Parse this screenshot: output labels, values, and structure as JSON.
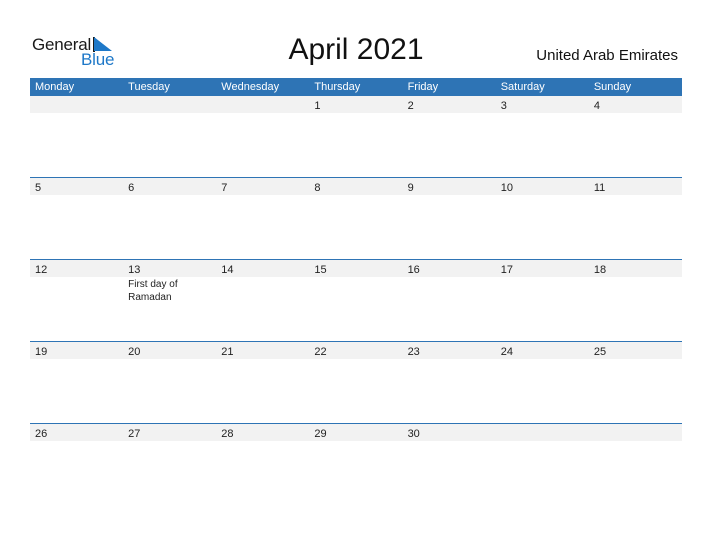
{
  "logo": {
    "word1": "General",
    "word2": "Blue",
    "accent_color": "#1e78c8"
  },
  "title": "April 2021",
  "country": "United Arab Emirates",
  "header_color": "#2e74b5",
  "weekdays": [
    "Monday",
    "Tuesday",
    "Wednesday",
    "Thursday",
    "Friday",
    "Saturday",
    "Sunday"
  ],
  "weeks": [
    {
      "days": [
        "",
        "",
        "",
        "1",
        "2",
        "3",
        "4"
      ],
      "events": [
        "",
        "",
        "",
        "",
        "",
        "",
        ""
      ]
    },
    {
      "days": [
        "5",
        "6",
        "7",
        "8",
        "9",
        "10",
        "11"
      ],
      "events": [
        "",
        "",
        "",
        "",
        "",
        "",
        ""
      ]
    },
    {
      "days": [
        "12",
        "13",
        "14",
        "15",
        "16",
        "17",
        "18"
      ],
      "events": [
        "",
        "First day of Ramadan",
        "",
        "",
        "",
        "",
        ""
      ]
    },
    {
      "days": [
        "19",
        "20",
        "21",
        "22",
        "23",
        "24",
        "25"
      ],
      "events": [
        "",
        "",
        "",
        "",
        "",
        "",
        ""
      ]
    },
    {
      "days": [
        "26",
        "27",
        "28",
        "29",
        "30",
        "",
        ""
      ],
      "events": [
        "",
        "",
        "",
        "",
        "",
        "",
        ""
      ]
    }
  ]
}
